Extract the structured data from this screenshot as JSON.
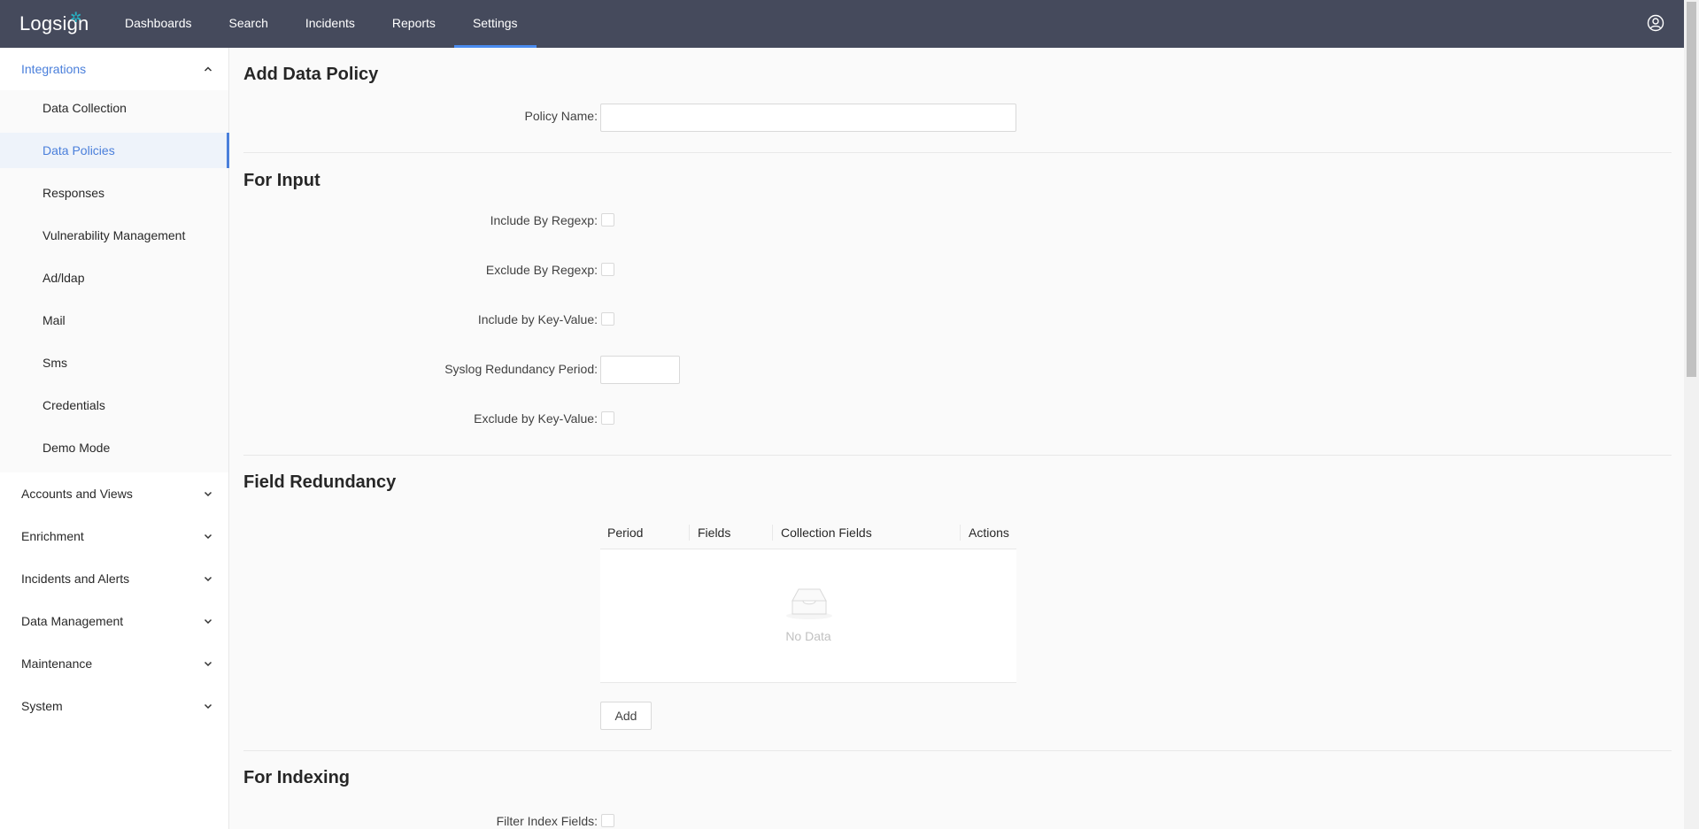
{
  "app": {
    "logo": "Logsign"
  },
  "nav": {
    "items": [
      {
        "label": "Dashboards"
      },
      {
        "label": "Search"
      },
      {
        "label": "Incidents"
      },
      {
        "label": "Reports"
      },
      {
        "label": "Settings"
      }
    ],
    "active": "Settings",
    "accent": "#4a8cf0"
  },
  "sidebar": {
    "open_group": {
      "label": "Integrations",
      "items": [
        {
          "label": "Data Collection"
        },
        {
          "label": "Data Policies"
        },
        {
          "label": "Responses"
        },
        {
          "label": "Vulnerability Management"
        },
        {
          "label": "Ad/ldap"
        },
        {
          "label": "Mail"
        },
        {
          "label": "Sms"
        },
        {
          "label": "Credentials"
        },
        {
          "label": "Demo Mode"
        }
      ],
      "selected": "Data Policies"
    },
    "groups": [
      {
        "label": "Accounts and Views"
      },
      {
        "label": "Enrichment"
      },
      {
        "label": "Incidents and Alerts"
      },
      {
        "label": "Data Management"
      },
      {
        "label": "Maintenance"
      },
      {
        "label": "System"
      }
    ],
    "selected_color": "#4a7fdb"
  },
  "main": {
    "title": "Add Data Policy",
    "policy_name": {
      "label": "Policy Name",
      "value": ""
    },
    "for_input": {
      "title": "For Input",
      "include_regexp": {
        "label": "Include By Regexp",
        "checked": false
      },
      "exclude_regexp": {
        "label": "Exclude By Regexp",
        "checked": false
      },
      "include_kv": {
        "label": "Include by Key-Value",
        "checked": false
      },
      "syslog_period": {
        "label": "Syslog Redundancy Period",
        "value": ""
      },
      "exclude_kv": {
        "label": "Exclude by Key-Value",
        "checked": false
      }
    },
    "field_redundancy": {
      "title": "Field Redundancy",
      "columns": [
        "Period",
        "Fields",
        "Collection Fields",
        "Actions"
      ],
      "empty_text": "No Data",
      "add_label": "Add"
    },
    "for_indexing": {
      "title": "For Indexing",
      "filter_index_fields": {
        "label": "Filter Index Fields",
        "checked": false
      }
    }
  },
  "label_suffix": ":"
}
